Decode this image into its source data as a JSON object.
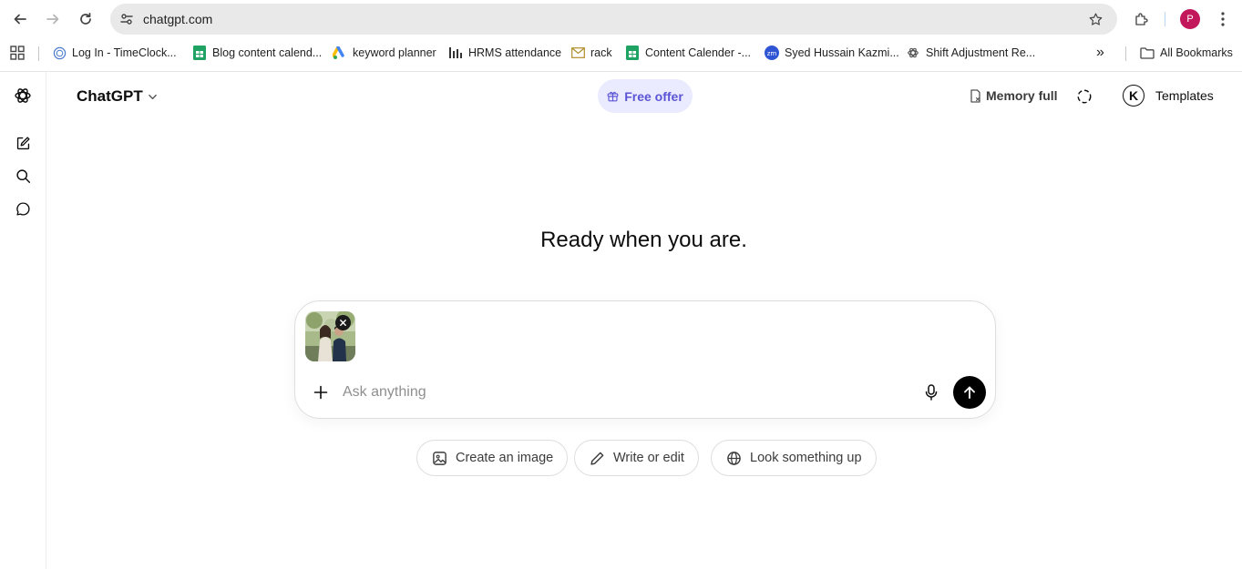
{
  "browser": {
    "url": "chatgpt.com",
    "profile_initial": "P",
    "colors": {
      "profile": "#c2185b",
      "omnibox": "#e9e9e9"
    }
  },
  "bookmarks": {
    "items": [
      {
        "label": "Log In - TimeClock...",
        "icon": "globe-icon"
      },
      {
        "label": "Blog content calend...",
        "icon": "sheets-icon"
      },
      {
        "label": "keyword planner",
        "icon": "ads-icon"
      },
      {
        "label": "HRMS attendance",
        "icon": "level-icon"
      },
      {
        "label": "rack",
        "icon": "mail-icon"
      },
      {
        "label": "Content Calender -...",
        "icon": "sheets-icon"
      },
      {
        "label": "Syed Hussain Kazmi...",
        "icon": "zoominfo-icon"
      },
      {
        "label": "Shift Adjustment Re...",
        "icon": "openai-icon"
      }
    ],
    "more": "»",
    "all_bookmarks": "All Bookmarks"
  },
  "header": {
    "model": "ChatGPT",
    "free_offer": "Free offer",
    "memory": "Memory full",
    "avatar_initial": "K",
    "templates": "Templates",
    "colors": {
      "free_offer_bg": "#ebebff",
      "free_offer_text": "#5b55d6"
    }
  },
  "main": {
    "headline": "Ready when you are.",
    "composer": {
      "placeholder": "Ask anything",
      "attachment": "photo"
    },
    "chips": [
      {
        "label": "Create an image",
        "icon": "image-icon"
      },
      {
        "label": "Write or edit",
        "icon": "pencil-icon"
      },
      {
        "label": "Look something up",
        "icon": "globe-icon"
      }
    ]
  }
}
